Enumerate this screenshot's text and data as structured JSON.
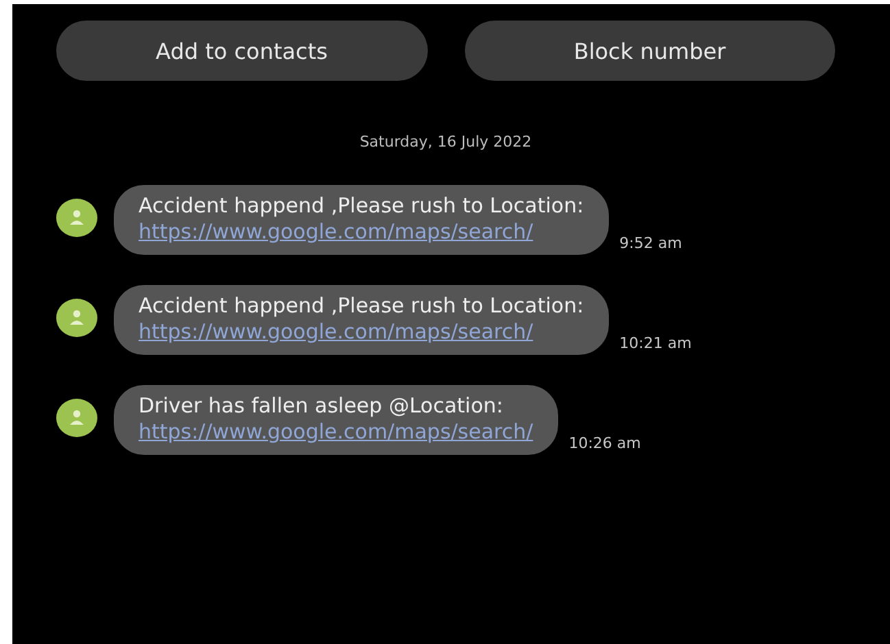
{
  "actions": [
    "Add to contacts",
    "Block number"
  ],
  "date": "Saturday, 16 July 2022",
  "messages": [
    {
      "text": "Accident happend ,Please rush to Location:",
      "link": "https://www.google.com/maps/search/",
      "time": "9:52 am"
    },
    {
      "text": "Accident happend ,Please rush to Location:",
      "link": "https://www.google.com/maps/search/",
      "time": "10:21 am"
    },
    {
      "text": "Driver has fallen asleep @Location:",
      "link": "https://www.google.com/maps/search/",
      "time": "10:26 am"
    }
  ]
}
